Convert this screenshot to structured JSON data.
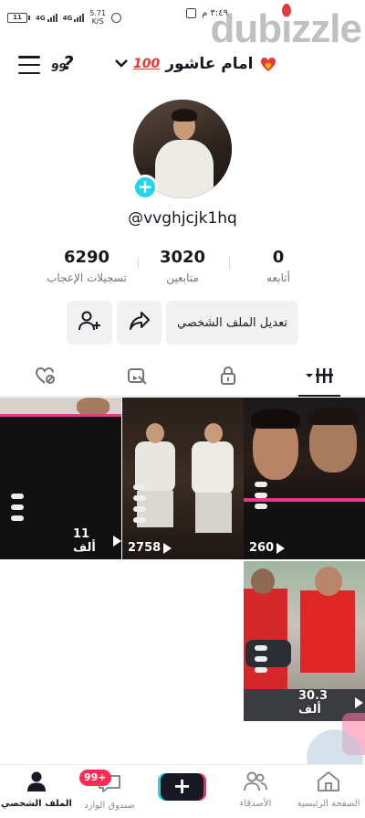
{
  "status_bar": {
    "battery": "11",
    "signal_1": "4G",
    "signal_2": "4G",
    "speed_value": "5.71",
    "speed_unit": "K/S",
    "time": "٣:٤٩ م"
  },
  "watermark": "dubizzle",
  "header": {
    "username": "امام عاشور",
    "hundred_emoji": "100",
    "qna": "?"
  },
  "profile": {
    "handle": "@vvghjcjk1hq"
  },
  "stats": [
    {
      "value": "0",
      "label": "أتابعه"
    },
    {
      "value": "3020",
      "label": "متابعين"
    },
    {
      "value": "6290",
      "label": "تسجيلات الإعجاب"
    }
  ],
  "actions": {
    "edit_profile": "تعديل الملف الشخصي"
  },
  "tabs": [
    {
      "name": "videos",
      "icon": "grid-icon"
    },
    {
      "name": "private",
      "icon": "lock-icon"
    },
    {
      "name": "reposts",
      "icon": "repost-hidden-icon"
    },
    {
      "name": "liked",
      "icon": "heart-hidden-icon"
    }
  ],
  "videos": [
    {
      "views": "260"
    },
    {
      "views": "2758"
    },
    {
      "views": "11 ألف"
    },
    {
      "views": "30.3 ألف"
    }
  ],
  "bottom_nav": {
    "home": "الصفحة الرئيسية",
    "friends": "الأصدقاء",
    "create": "+",
    "inbox": "صندوق الوارد",
    "inbox_badge": "99+",
    "profile": "الملف الشخصي"
  },
  "colors": {
    "accent_cyan": "#20d5ec",
    "accent_red": "#fe2c55",
    "text": "#161823"
  }
}
